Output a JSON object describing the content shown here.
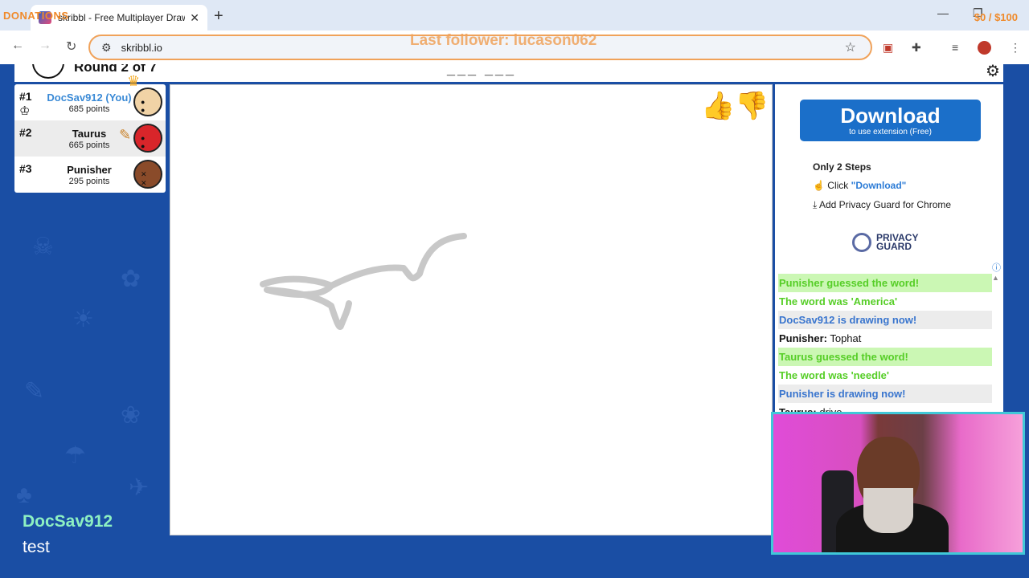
{
  "browser": {
    "tab_title": "skribbl - Free Multiplayer Drawi",
    "url": "skribbl.io",
    "icons": {
      "back": "back-arrow-icon",
      "forward": "forward-arrow-icon",
      "reload": "reload-icon",
      "star": "bookmark-star-icon"
    }
  },
  "stream_overlay": {
    "donations_label": "DONATIONS",
    "money_goal": "$0 / $100",
    "last_follower": "Last follower: lucason062",
    "chat_name": "DocSav912",
    "chat_message": "test"
  },
  "game": {
    "round_text": "Round 2 of 7",
    "word_hint": "___ ___",
    "players": [
      {
        "rank": "#1",
        "name": "DocSav912 (You)",
        "points": "685 points",
        "is_you": true
      },
      {
        "rank": "#2",
        "name": "Taurus",
        "points": "665 points",
        "is_you": false
      },
      {
        "rank": "#3",
        "name": "Punisher",
        "points": "295 points",
        "is_you": false
      }
    ]
  },
  "extension_ad": {
    "download_label": "Download",
    "download_sub": "to use extension (Free)",
    "steps_title": "Only 2 Steps",
    "step1_prefix": "Click ",
    "step1_link": "\"Download\"",
    "step2": "Add Privacy Guard for Chrome",
    "brand_line1": "PRIVACY",
    "brand_line2": "GUARD"
  },
  "chat": [
    {
      "type": "guess",
      "text": "Punisher guessed the word!"
    },
    {
      "type": "word",
      "text": "The word was 'America'"
    },
    {
      "type": "draw",
      "text": "DocSav912 is drawing now!"
    },
    {
      "type": "plain",
      "author": "Punisher:",
      "text": " Tophat"
    },
    {
      "type": "guess",
      "text": "Taurus guessed the word!"
    },
    {
      "type": "word",
      "text": "The word was 'needle'"
    },
    {
      "type": "draw",
      "text": "Punisher is drawing now!"
    },
    {
      "type": "plain",
      "author": "Taurus:",
      "text": " drive"
    }
  ],
  "colors": {
    "page_bg": "#1a4ea4",
    "download_btn": "#1b6fc9",
    "guess_green": "#56ce27",
    "draw_blue": "#3975ce"
  }
}
